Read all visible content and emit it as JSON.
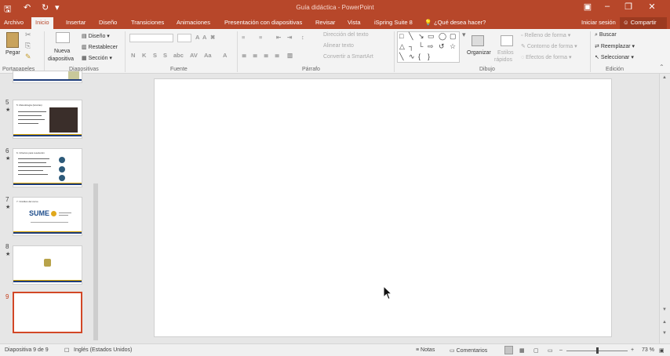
{
  "window": {
    "title": "Guía didáctica - PowerPoint"
  },
  "ribbon_tabs": [
    "Archivo",
    "Inicio",
    "Insertar",
    "Diseño",
    "Transiciones",
    "Animaciones",
    "Presentación con diapositivas",
    "Revisar",
    "Vista",
    "iSpring Suite 8"
  ],
  "tell_me": "¿Qué desea hacer?",
  "account": {
    "signin": "Iniciar sesión",
    "share": "Compartir"
  },
  "groups": {
    "clipboard": {
      "label": "Portapapeles",
      "paste": "Pegar"
    },
    "slides": {
      "label": "Diapositivas",
      "new_slide_1": "Nueva",
      "new_slide_2": "diapositiva",
      "layout": "Diseño",
      "reset": "Restablecer",
      "section": "Sección"
    },
    "font": {
      "label": "Fuente"
    },
    "paragraph": {
      "label": "Párrafo",
      "text_direction": "Dirección del texto",
      "align_text": "Alinear texto",
      "smartart": "Convertir a SmartArt"
    },
    "drawing": {
      "label": "Dibujo",
      "arrange": "Organizar",
      "quick_styles_1": "Estilos",
      "quick_styles_2": "rápidos",
      "fill": "Relleno de forma",
      "outline": "Contorno de forma",
      "effects": "Efectos de forma"
    },
    "editing": {
      "label": "Edición",
      "find": "Buscar",
      "replace": "Reemplazar",
      "select": "Seleccionar"
    }
  },
  "slides_panel": {
    "numbers": [
      "5",
      "6",
      "7",
      "8",
      "9"
    ],
    "thumb_texts": {
      "s5": "5. Metodología (tutorías)",
      "s6": "6. Criterios para resolución",
      "s7": "7. Créditos del curso",
      "s7_logo": "SUME"
    }
  },
  "status": {
    "slide_count": "Diapositiva 9 de 9",
    "language": "Inglés (Estados Unidos)",
    "notes": "Notas",
    "comments": "Comentarios",
    "zoom": "73 %"
  },
  "colors": {
    "accent": "#b7472a",
    "selection": "#d24726"
  }
}
